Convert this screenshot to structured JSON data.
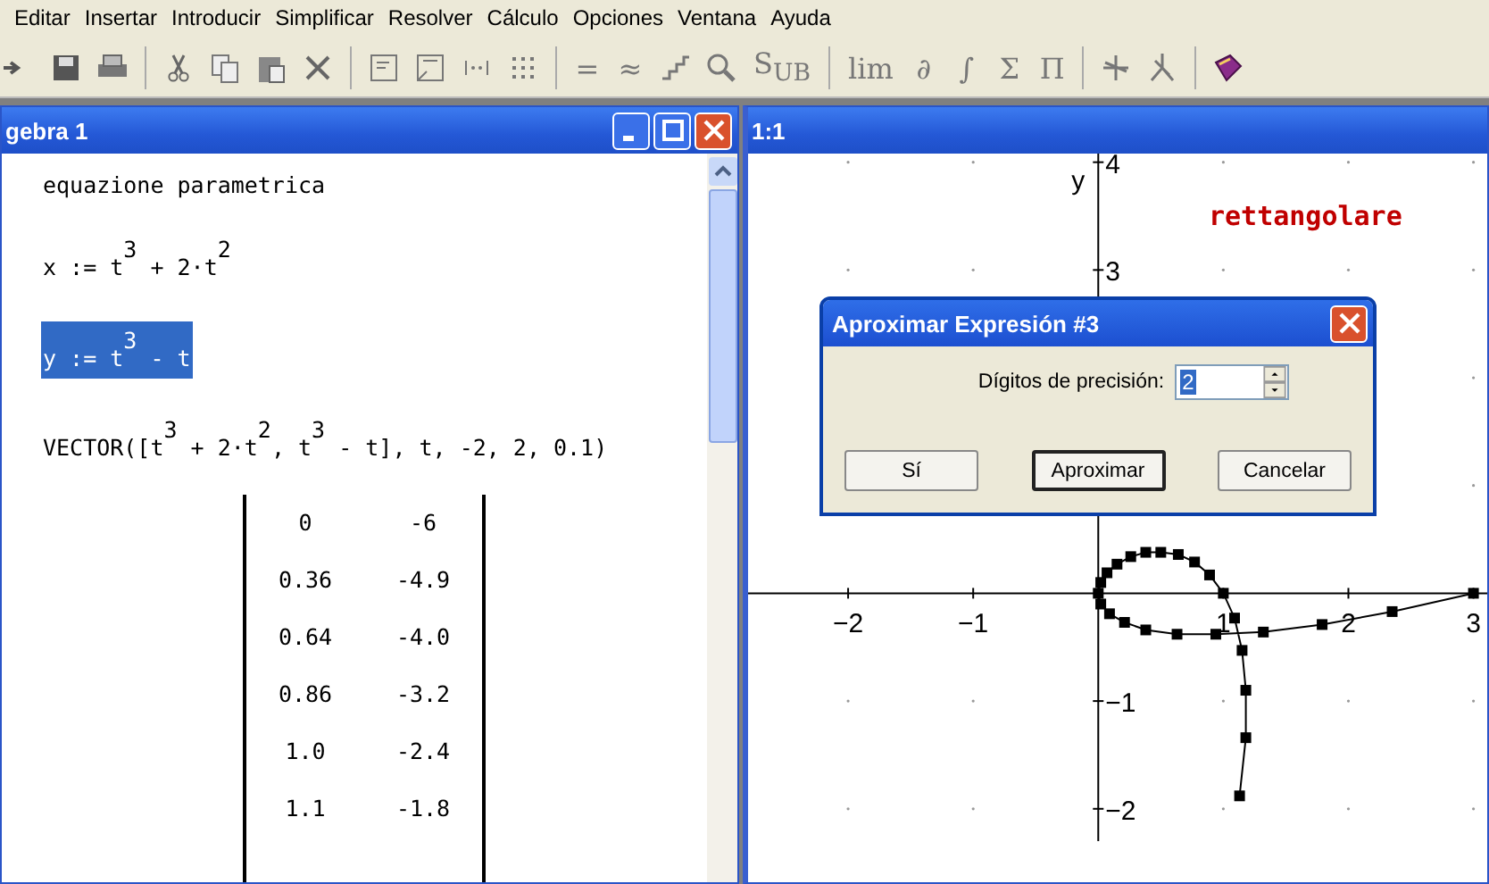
{
  "menu": [
    "Editar",
    "Insertar",
    "Introducir",
    "Simplificar",
    "Resolver",
    "Cálculo",
    "Opciones",
    "Ventana",
    "Ayuda"
  ],
  "toolbar_glyphs": [
    "=",
    "≈",
    "S$_{UB}$",
    "lim",
    "∂",
    "∫",
    "Σ",
    "Π"
  ],
  "left_window": {
    "title": "gebra 1",
    "expressions": [
      {
        "kind": "text",
        "text": "equazione parametrica",
        "selected": false
      },
      {
        "kind": "math",
        "text": "x := t$^{3}$ + 2·t$^{2}$",
        "selected": false
      },
      {
        "kind": "math",
        "text": "y := t$^{3}$ - t",
        "selected": true
      },
      {
        "kind": "math",
        "text": "VECTOR([t$^{3}$ + 2·t$^{2}$, t$^{3}$ - t], t, -2, 2, 0.1)",
        "selected": false
      },
      {
        "kind": "matrix",
        "selected": false,
        "rows": [
          [
            "0",
            "-6"
          ],
          [
            "0.36",
            "-4.9"
          ],
          [
            "0.64",
            "-4.0"
          ],
          [
            "0.86",
            "-3.2"
          ],
          [
            "1.0",
            "-2.4"
          ],
          [
            "1.1",
            "-1.8"
          ]
        ]
      }
    ]
  },
  "right_window": {
    "title": "1:1",
    "annotation": "rettangolare",
    "chart_data": {
      "type": "line",
      "ylabel": "y",
      "xlim": [
        -2.8,
        3.11
      ],
      "ylim": [
        -2.3,
        4.08
      ],
      "xticks": [
        -2,
        -1,
        1,
        2,
        3
      ],
      "yticks": [
        -2,
        -1,
        3,
        4
      ],
      "x": [
        1.13,
        1.18,
        1.18,
        1.15,
        1.09,
        1,
        0.89,
        0.77,
        0.64,
        0.5,
        0.38,
        0.26,
        0.15,
        0.07,
        0.02,
        0,
        0.02,
        0.09,
        0.21,
        0.38,
        0.63,
        0.94,
        1.32,
        1.79,
        2.35,
        3
      ],
      "series": [
        {
          "color": "#000000",
          "marker": "square",
          "values": [
            -1.88,
            -1.34,
            -0.9,
            -0.53,
            -0.23,
            0,
            0.17,
            0.29,
            0.36,
            0.38,
            0.38,
            0.34,
            0.27,
            0.19,
            0.1,
            0,
            -0.1,
            -0.19,
            -0.27,
            -0.34,
            -0.38,
            -0.38,
            -0.36,
            -0.29,
            -0.17,
            0
          ]
        }
      ]
    }
  },
  "dialog": {
    "title": "Aproximar Expresión #3",
    "field_label": "Dígitos de precisión:",
    "field_value": "2",
    "buttons": [
      {
        "label": "Sí",
        "default": false
      },
      {
        "label": "Aproximar",
        "default": true
      },
      {
        "label": "Cancelar",
        "default": false
      }
    ]
  }
}
